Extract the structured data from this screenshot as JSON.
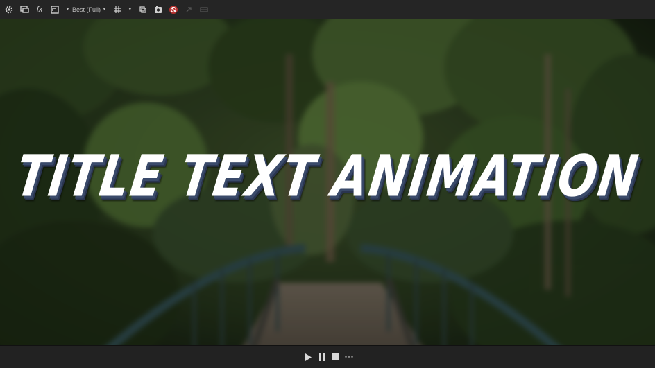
{
  "toolbar": {
    "buttons": [
      {
        "name": "gear-icon"
      },
      {
        "name": "monitor-icon"
      },
      {
        "name": "fx-icon",
        "label": "fx"
      },
      {
        "name": "overlay-icon"
      },
      {
        "name": "resolution-dropdown"
      },
      {
        "name": "grid-icon"
      },
      {
        "name": "loop-icon"
      },
      {
        "name": "snapshot-icon"
      },
      {
        "name": "stop-record-icon"
      },
      {
        "name": "link-icon"
      },
      {
        "name": "film-icon"
      }
    ],
    "fx_label": "fx",
    "resolution": {
      "value": "Best (Full)"
    },
    "accent_color": "#d23a3a"
  },
  "viewer": {
    "title_text": "TITLE TEXT ANIMATION"
  },
  "transport": {
    "more_label": "•••"
  }
}
